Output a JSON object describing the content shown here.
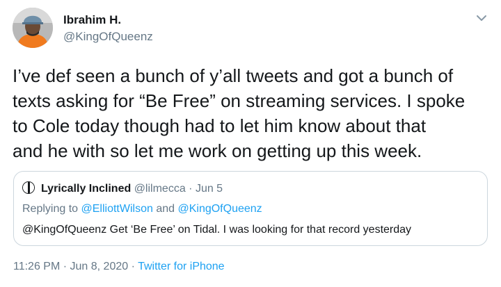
{
  "author": {
    "display_name": "Ibrahim H.",
    "handle": "@KingOfQueenz",
    "avatar_icon": "profile-photo"
  },
  "tweet": {
    "lines": [
      "I’ve def seen a bunch of y’all tweets and got a bunch of",
      "texts asking for “Be Free” on streaming services. I spoke",
      "to Cole today though had to let him know about that",
      "and he with so let me work on getting up this week."
    ]
  },
  "quoted_tweet": {
    "display_name": "Lyrically Inclined",
    "handle": "@lilmecca",
    "separator": " · ",
    "date": "Jun 5",
    "replying_prefix": "Replying to ",
    "replying_user_1": "@ElliottWilson",
    "replying_and": " and ",
    "replying_user_2": "@KingOfQueenz",
    "text": "@KingOfQueenz Get ‘Be Free’ on Tidal. I was looking for that record yesterday"
  },
  "meta": {
    "time": "11:26 PM",
    "separator": " · ",
    "date": "Jun 8, 2020",
    "source": "Twitter for iPhone"
  },
  "colors": {
    "link": "#1da1f2",
    "secondary_text": "#657786",
    "primary_text": "#14171a",
    "border": "#ccd6dd"
  }
}
